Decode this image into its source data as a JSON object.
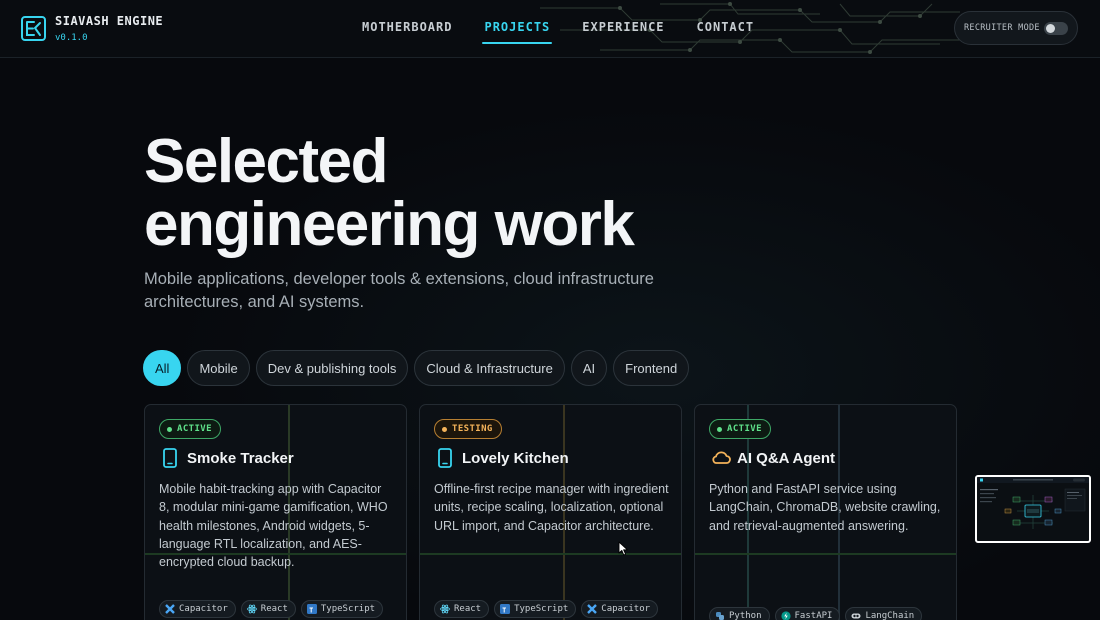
{
  "brand": {
    "title": "SIAVASH ENGINE",
    "version": "v0.1.0",
    "accent": "#38d5f0"
  },
  "nav": {
    "items": [
      {
        "label": "MOTHERBOARD",
        "active": false
      },
      {
        "label": "PROJECTS",
        "active": true
      },
      {
        "label": "EXPERIENCE",
        "active": false
      },
      {
        "label": "CONTACT",
        "active": false
      }
    ]
  },
  "recruiter": {
    "label": "RECRUITER MODE",
    "enabled": false
  },
  "hero": {
    "title_line1": "Selected",
    "title_line2": "engineering work",
    "subtitle": "Mobile applications, developer tools & extensions, cloud infrastructure architectures, and AI systems."
  },
  "filters": [
    {
      "label": "All",
      "active": true
    },
    {
      "label": "Mobile",
      "active": false
    },
    {
      "label": "Dev & publishing tools",
      "active": false
    },
    {
      "label": "Cloud & Infrastructure",
      "active": false
    },
    {
      "label": "AI",
      "active": false
    },
    {
      "label": "Frontend",
      "active": false
    }
  ],
  "projects": [
    {
      "status": "ACTIVE",
      "status_color": "#5fe08a",
      "icon": "phone-icon",
      "title": "Smoke Tracker",
      "description": "Mobile habit-tracking app with Capacitor 8, modular mini-game gamification, WHO health milestones, Android widgets, 5-language RTL localization, and AES-encrypted cloud backup.",
      "tags": [
        {
          "label": "Capacitor",
          "icon": "capacitor-icon"
        },
        {
          "label": "React",
          "icon": "react-icon"
        },
        {
          "label": "TypeScript",
          "icon": "typescript-icon"
        }
      ]
    },
    {
      "status": "TESTING",
      "status_color": "#f4b35a",
      "icon": "phone-icon",
      "title": "Lovely Kitchen",
      "description": "Offline-first recipe manager with ingredient units, recipe scaling, localization, optional URL import, and Capacitor architecture.",
      "tags": [
        {
          "label": "React",
          "icon": "react-icon"
        },
        {
          "label": "TypeScript",
          "icon": "typescript-icon"
        },
        {
          "label": "Capacitor",
          "icon": "capacitor-icon"
        }
      ]
    },
    {
      "status": "ACTIVE",
      "status_color": "#5fe08a",
      "icon": "cloud-icon",
      "title": "AI Q&A Agent",
      "description": "Python and FastAPI service using LangChain, ChromaDB, website crawling, and retrieval-augmented answering.",
      "tags": [
        {
          "label": "Python",
          "icon": "python-icon"
        },
        {
          "label": "FastAPI",
          "icon": "fastapi-icon"
        },
        {
          "label": "LangChain",
          "icon": "langchain-icon"
        }
      ]
    }
  ]
}
